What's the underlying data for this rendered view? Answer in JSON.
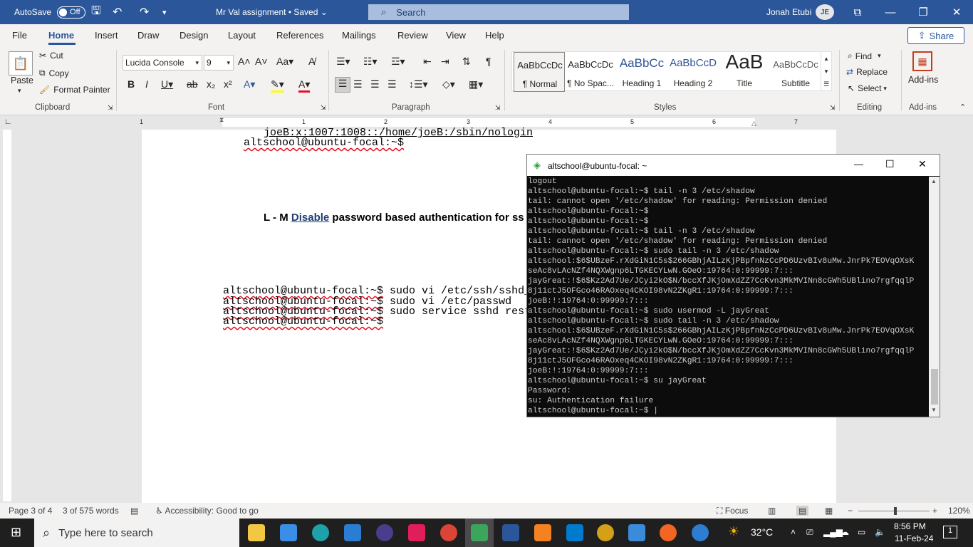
{
  "titlebar": {
    "autosave": "AutoSave",
    "toggle": "Off",
    "doc_title": "Mr Val assignment • Saved ⌄",
    "search": "Search",
    "user": "Jonah Etubi",
    "initials": "JE"
  },
  "tabs": [
    "File",
    "Home",
    "Insert",
    "Draw",
    "Design",
    "Layout",
    "References",
    "Mailings",
    "Review",
    "View",
    "Help"
  ],
  "share": "Share",
  "ribbon": {
    "clipboard": {
      "paste": "Paste",
      "cut": "Cut",
      "copy": "Copy",
      "format_painter": "Format Painter",
      "label": "Clipboard"
    },
    "font": {
      "name": "Lucida Console",
      "size": "9",
      "label": "Font"
    },
    "paragraph": {
      "label": "Paragraph"
    },
    "styles": {
      "items": [
        {
          "preview": "AaBbCcDc",
          "name": "¶ Normal"
        },
        {
          "preview": "AaBbCcDc",
          "name": "¶ No Spac..."
        },
        {
          "preview": "AaBbCc",
          "name": "Heading 1"
        },
        {
          "preview": "AaBbCcD",
          "name": "Heading 2"
        },
        {
          "preview": "AaB",
          "name": "Title"
        },
        {
          "preview": "AaBbCcDc",
          "name": "Subtitle"
        }
      ],
      "label": "Styles"
    },
    "editing": {
      "find": "Find",
      "replace": "Replace",
      "select": "Select",
      "label": "Editing"
    },
    "addins": {
      "button": "Add-ins",
      "label": "Add-ins"
    }
  },
  "ruler_numbers": [
    "1",
    "1",
    "2",
    "3",
    "4",
    "5",
    "6",
    "7"
  ],
  "document": {
    "line1": "joeB:x:1007:1008::/home/joeB:/sbin/nologin",
    "line2": "altschool@ubuntu-focal:~$",
    "heading_prefix": "L - M ",
    "heading_link": "Disable",
    "heading_rest": " password based authentication for ss",
    "cmd_prompt": "altschool@ubuntu-focal:~$",
    "cmd1": " sudo vi /etc/ssh/sshd_co",
    "cmd2": " sudo vi /etc/passwd",
    "cmd3": " sudo service sshd resta",
    "cmd4": ""
  },
  "terminal": {
    "title": "altschool@ubuntu-focal: ~",
    "lines": [
      "logout",
      "altschool@ubuntu-focal:~$ tail -n 3 /etc/shadow",
      "tail: cannot open '/etc/shadow' for reading: Permission denied",
      "altschool@ubuntu-focal:~$",
      "altschool@ubuntu-focal:~$",
      "altschool@ubuntu-focal:~$ tail -n 3 /etc/shadow",
      "tail: cannot open '/etc/shadow' for reading: Permission denied",
      "altschool@ubuntu-focal:~$ sudo tail -n 3 /etc/shadow",
      "altschool:$6$UBzeF.rXdGiN1C5s$266GBhjAILzKjPBpfnNzCcPD6UzvBIv8uMw.JnrPk7EOVqOXsK",
      "seAc8vLAcNZf4NQXWgnp6LTGKECYLwN.GOeO:19764:0:99999:7:::",
      "jayGreat:!$6$Kz2Ad7Ue/JCyi2kO$N/bccXfJKjOmXdZZ7CcKvn3MkMVINn8cGWh5UBlino7rgfqqlP",
      "8j11ctJ5OFGco46RAOxeq4CKOI98vN2ZKgR1:19764:0:99999:7:::",
      "joeB:!:19764:0:99999:7:::",
      "altschool@ubuntu-focal:~$ sudo usermod -L jayGreat",
      "altschool@ubuntu-focal:~$ sudo tail -n 3 /etc/shadow",
      "altschool:$6$UBzeF.rXdGiN1C5s$266GBhjAILzKjPBpfnNzCcPD6UzvBIv8uMw.JnrPk7EOVqOXsK",
      "seAc8vLAcNZf4NQXWgnp6LTGKECYLwN.GOeO:19764:0:99999:7:::",
      "jayGreat:!$6$Kz2Ad7Ue/JCyi2kO$N/bccXfJKjOmXdZZ7CcKvn3MkMVINn8cGWh5UBlino7rgfqqlP",
      "8j11ctJ5OFGco46RAOxeq4CKOI98vN2ZKgR1:19764:0:99999:7:::",
      "joeB:!:19764:0:99999:7:::",
      "altschool@ubuntu-focal:~$ su jayGreat",
      "Password:",
      "su: Authentication failure",
      "altschool@ubuntu-focal:~$ |"
    ]
  },
  "status": {
    "page": "Page 3 of 4",
    "words": "3 of 575 words",
    "accessibility": "Accessibility: Good to go",
    "focus": "Focus",
    "zoom": "120%"
  },
  "taskbar": {
    "search": "Type here to search",
    "weather": "32°C",
    "time": "8:56 PM",
    "date": "11-Feb-24",
    "notif": "1"
  }
}
